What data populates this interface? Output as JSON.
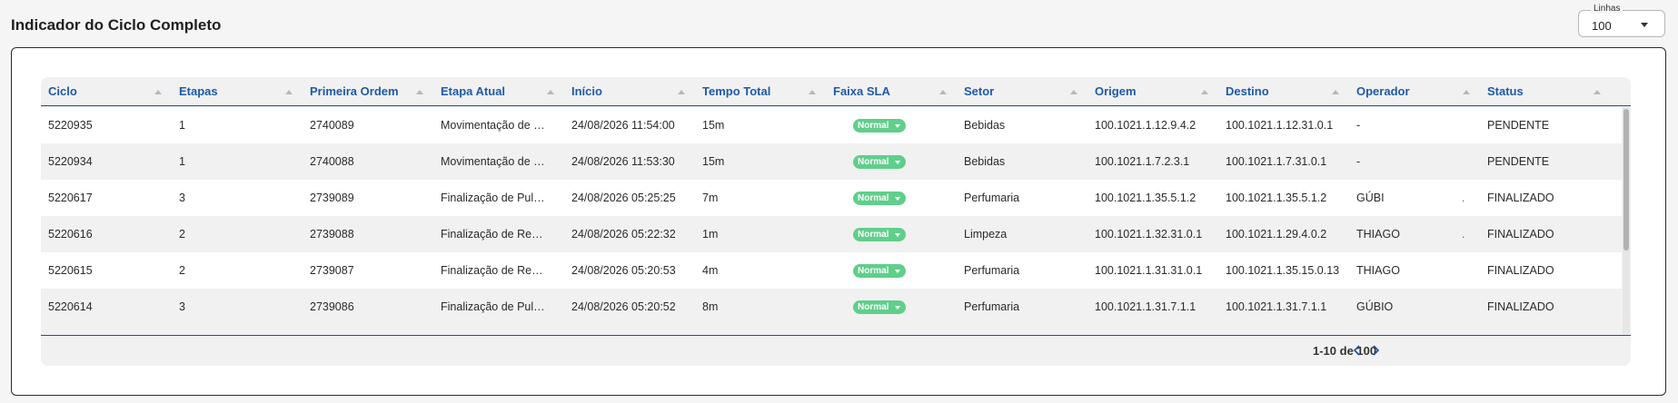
{
  "page": {
    "title": "Indicador do Ciclo Completo"
  },
  "lines_select": {
    "legend": "Linhas",
    "value": "100"
  },
  "table": {
    "columns": [
      "Ciclo",
      "Etapas",
      "Primeira Ordem",
      "Etapa Atual",
      "Início",
      "Tempo Total",
      "Faixa SLA",
      "Setor",
      "Origem",
      "Destino",
      "Operador",
      "Status"
    ],
    "rows": [
      {
        "ciclo": "5220935",
        "etapas": "1",
        "primeira_ordem": "2740089",
        "etapa_atual": "Movimentação de P...",
        "inicio": "24/08/2026 11:54:00",
        "tempo_total": "15m",
        "faixa_sla": "Normal",
        "setor": "Bebidas",
        "origem": "100.1021.1.12.9.4.2",
        "destino": "100.1021.1.12.31.0.1",
        "operador": "-",
        "marker": "",
        "status": "PENDENTE"
      },
      {
        "ciclo": "5220934",
        "etapas": "1",
        "primeira_ordem": "2740088",
        "etapa_atual": "Movimentação de P...",
        "inicio": "24/08/2026 11:53:30",
        "tempo_total": "15m",
        "faixa_sla": "Normal",
        "setor": "Bebidas",
        "origem": "100.1021.1.7.2.3.1",
        "destino": "100.1021.1.7.31.0.1",
        "operador": "-",
        "marker": "",
        "status": "PENDENTE"
      },
      {
        "ciclo": "5220617",
        "etapas": "3",
        "primeira_ordem": "2739089",
        "etapa_atual": "Finalização de Pulm...",
        "inicio": "24/08/2026 05:25:25",
        "tempo_total": "7m",
        "faixa_sla": "Normal",
        "setor": "Perfumaria",
        "origem": "100.1021.1.35.5.1.2",
        "destino": "100.1021.1.35.5.1.2",
        "operador": "GÚBI",
        "marker": ".",
        "status": "FINALIZADO"
      },
      {
        "ciclo": "5220616",
        "etapas": "2",
        "primeira_ordem": "2739088",
        "etapa_atual": "Finalização de Ress...",
        "inicio": "24/08/2026 05:22:32",
        "tempo_total": "1m",
        "faixa_sla": "Normal",
        "setor": "Limpeza",
        "origem": "100.1021.1.32.31.0.1",
        "destino": "100.1021.1.29.4.0.2",
        "operador": "THIAGO",
        "marker": ".",
        "status": "FINALIZADO"
      },
      {
        "ciclo": "5220615",
        "etapas": "2",
        "primeira_ordem": "2739087",
        "etapa_atual": "Finalização de Ress...",
        "inicio": "24/08/2026 05:20:53",
        "tempo_total": "4m",
        "faixa_sla": "Normal",
        "setor": "Perfumaria",
        "origem": "100.1021.1.31.31.0.1",
        "destino": "100.1021.1.35.15.0.13",
        "operador": "THIAGO",
        "marker": "",
        "status": "FINALIZADO"
      },
      {
        "ciclo": "5220614",
        "etapas": "3",
        "primeira_ordem": "2739086",
        "etapa_atual": "Finalização de Pulm...",
        "inicio": "24/08/2026 05:20:52",
        "tempo_total": "8m",
        "faixa_sla": "Normal",
        "setor": "Perfumaria",
        "origem": "100.1021.1.31.7.1.1",
        "destino": "100.1021.1.31.7.1.1",
        "operador": "GÚBIO",
        "marker": "",
        "status": "FINALIZADO"
      }
    ]
  },
  "pagination": {
    "range": "1-10 de 100"
  },
  "colors": {
    "accent": "#1e5aa8",
    "header_rule": "#1e4f95",
    "sla_normal": "#5fcf8a"
  },
  "icons": {
    "sort": "sort-asc-icon",
    "select_caret": "chevron-down-icon",
    "prev": "chevron-left-icon",
    "next": "chevron-right-icon"
  }
}
